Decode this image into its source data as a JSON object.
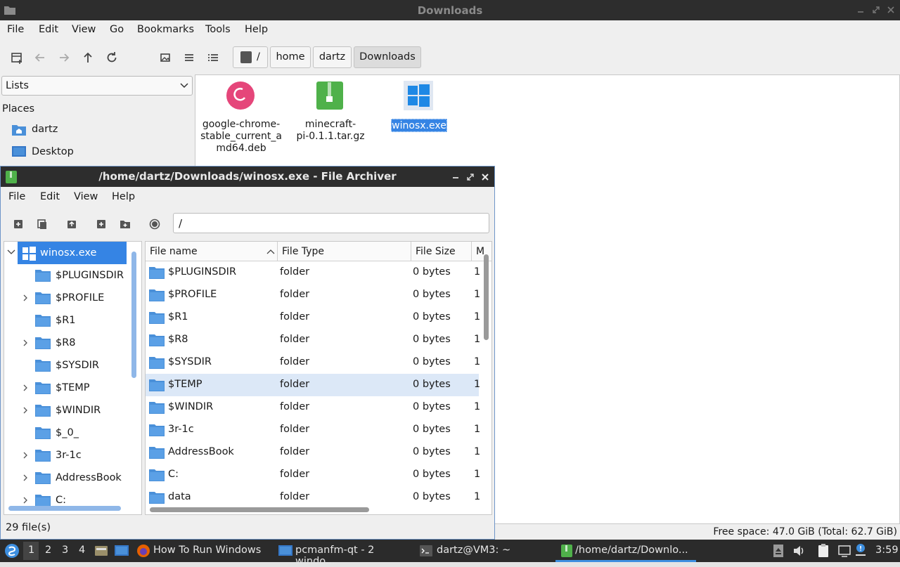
{
  "fm": {
    "title": "Downloads",
    "menu": [
      "File",
      "Edit",
      "View",
      "Go",
      "Bookmarks",
      "Tools",
      "Help"
    ],
    "crumbs": [
      "/",
      "home",
      "dartz",
      "Downloads"
    ],
    "side_combo": "Lists",
    "places_label": "Places",
    "places": [
      "dartz",
      "Desktop"
    ],
    "files": [
      "google-chrome-stable_current_amd64.deb",
      "minecraft-pi-0.1.1.tar.gz",
      "winosx.exe"
    ],
    "file_lines": [
      [
        "google-chrome-",
        "stable_current_a",
        "md64.deb"
      ],
      [
        "minecraft-",
        "pi-0.1.1.tar.gz"
      ],
      [
        "winosx.exe"
      ]
    ],
    "status": "Free space: 47.0 GiB (Total: 62.7 GiB)"
  },
  "archiver": {
    "title": "/home/dartz/Downloads/winosx.exe - File Archiver",
    "menu": [
      "File",
      "Edit",
      "View",
      "Help"
    ],
    "path": "/",
    "tree_root": "winosx.exe",
    "tree": [
      "$PLUGINSDIR",
      "$PROFILE",
      "$R1",
      "$R8",
      "$SYSDIR",
      "$TEMP",
      "$WINDIR",
      "$_0_",
      "3r-1c",
      "AddressBook",
      "C:"
    ],
    "columns": [
      "File name",
      "File Type",
      "File Size",
      "M"
    ],
    "rows": [
      {
        "name": "$PLUGINSDIR",
        "type": "folder",
        "size": "0 bytes",
        "m": "1"
      },
      {
        "name": "$PROFILE",
        "type": "folder",
        "size": "0 bytes",
        "m": "1"
      },
      {
        "name": "$R1",
        "type": "folder",
        "size": "0 bytes",
        "m": "1"
      },
      {
        "name": "$R8",
        "type": "folder",
        "size": "0 bytes",
        "m": "1"
      },
      {
        "name": "$SYSDIR",
        "type": "folder",
        "size": "0 bytes",
        "m": "1"
      },
      {
        "name": "$TEMP",
        "type": "folder",
        "size": "0 bytes",
        "m": "1"
      },
      {
        "name": "$WINDIR",
        "type": "folder",
        "size": "0 bytes",
        "m": "1"
      },
      {
        "name": "3r-1c",
        "type": "folder",
        "size": "0 bytes",
        "m": "1"
      },
      {
        "name": "AddressBook",
        "type": "folder",
        "size": "0 bytes",
        "m": "1"
      },
      {
        "name": "C:",
        "type": "folder",
        "size": "0 bytes",
        "m": "1"
      },
      {
        "name": "data",
        "type": "folder",
        "size": "0 bytes",
        "m": "1"
      }
    ],
    "status": "29 file(s)"
  },
  "taskbar": {
    "workspaces": [
      "1",
      "2",
      "3",
      "4"
    ],
    "tasks": [
      "How To Run Windows ...",
      "pcmanfm-qt - 2 windo...",
      "dartz@VM3: ~",
      "/home/dartz/Downlo..."
    ],
    "clock": "3:59"
  },
  "colors": {
    "accent": "#3d8fe0",
    "folder": "#4a90d9",
    "selection": "#3584e4",
    "titlebar": "#2d2d2d"
  }
}
